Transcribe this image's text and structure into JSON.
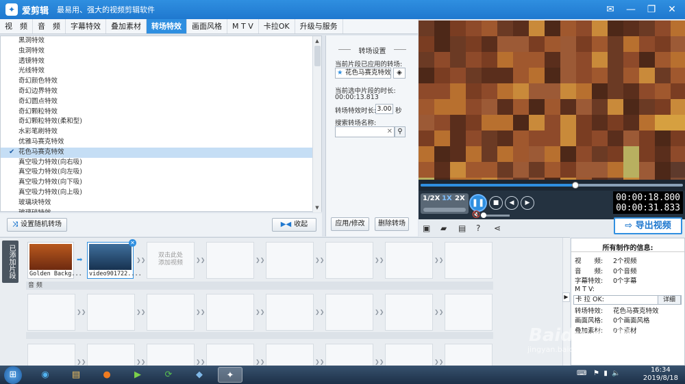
{
  "titlebar": {
    "logo": "✦",
    "title": "爱剪辑",
    "slogan": "最易用、强大的视频剪辑软件",
    "controls": [
      "✉",
      "—",
      "❐",
      "✕"
    ]
  },
  "tabs": [
    {
      "label": "视　频"
    },
    {
      "label": "音　频"
    },
    {
      "label": "字幕特效"
    },
    {
      "label": "叠加素材"
    },
    {
      "label": "转场特效",
      "active": true
    },
    {
      "label": "画面风格"
    },
    {
      "label": "M T V"
    },
    {
      "label": "卡拉OK"
    },
    {
      "label": "升级与服务"
    }
  ],
  "effects": [
    "黑洞特效",
    "虫洞特效",
    "透镜特效",
    "光线特效",
    "奇幻颜色特效",
    "奇幻边界特效",
    "奇幻圆点特效",
    "奇幻颗粒特效",
    "奇幻颗粒特效(柔和型)",
    "水彩笔刷特效",
    "优雅马赛克特效",
    "花色马赛克特效",
    "真空吸力特效(向右吸)",
    "真空吸力特效(向左吸)",
    "真空吸力特效(向下吸)",
    "真空吸力特效(向上吸)",
    "玻璃块特效",
    "玻璃碎特效"
  ],
  "selected_effect_index": 11,
  "effect_footer": {
    "random_label": "设置随机转场",
    "collapse_label": "收起"
  },
  "settings": {
    "title": "转场设置",
    "applied_label": "当前片段已应用的转场:",
    "applied_value": "花色马赛克特效",
    "clip_duration_label": "当前选中片段的时长:",
    "clip_duration_value": "00:00:13.813",
    "effect_duration_label": "转场特效时长:",
    "effect_duration_value": "3.00",
    "effect_duration_unit": "秒",
    "search_label": "搜索转场名称:",
    "search_value": "",
    "apply_label": "应用/修改",
    "delete_label": "删除转场"
  },
  "player": {
    "progress": 0.59,
    "speeds": [
      "1/2X",
      "1X",
      "2X"
    ],
    "active_speed": "1X",
    "volume": 0.0,
    "current_time": "00:00:18.800",
    "total_time": "00:00:31.833",
    "export_label": "导出视频"
  },
  "timeline": {
    "side_tab_label": "已添加片段",
    "clips": [
      {
        "label": "Golden Backg...",
        "colors": [
          "#b8591e",
          "#6e2a10"
        ]
      },
      {
        "label": "video901722....",
        "colors": [
          "#3f6f9c",
          "#173250"
        ],
        "selected": true
      }
    ],
    "add_hint": "双击此处\n添加视频",
    "audio_track_label": "音 频"
  },
  "info": {
    "title": "所有制作的信息:",
    "rows": [
      {
        "key": "视　　频:",
        "value": "2个视频"
      },
      {
        "key": "音　　频:",
        "value": "0个音频"
      },
      {
        "key": "字幕特效:",
        "value": "0个字幕"
      },
      {
        "key": "M T V:",
        "value": ""
      },
      {
        "key": "卡 拉 OK:",
        "value": "",
        "boxed": true,
        "button": "详细"
      },
      {
        "key": "转场特效:",
        "value": "花色马赛克特效"
      },
      {
        "key": "画面风格:",
        "value": "0个画面风格"
      },
      {
        "key": "叠加素材:",
        "value": "0个素材"
      }
    ]
  },
  "taskbar": {
    "icons": [
      {
        "name": "media-player-icon",
        "glyph": "◉",
        "color": "#52b3f0"
      },
      {
        "name": "file-explorer-icon",
        "glyph": "▤",
        "color": "#f0c060"
      },
      {
        "name": "firefox-icon",
        "glyph": "●",
        "color": "#f07b20"
      },
      {
        "name": "video-app-icon",
        "glyph": "▶",
        "color": "#7bd04a"
      },
      {
        "name": "refresh-app-icon",
        "glyph": "⟳",
        "color": "#58c050"
      },
      {
        "name": "photo-app-icon",
        "glyph": "◆",
        "color": "#7fb8e8"
      },
      {
        "name": "aijianji-app-icon",
        "glyph": "✦",
        "color": "#ffffff",
        "active": true
      }
    ],
    "clock_time": "16:34",
    "clock_date": "2019/8/18"
  },
  "watermark": {
    "text": "Baidu 经验",
    "sub": "jingyan.baidu.com"
  }
}
